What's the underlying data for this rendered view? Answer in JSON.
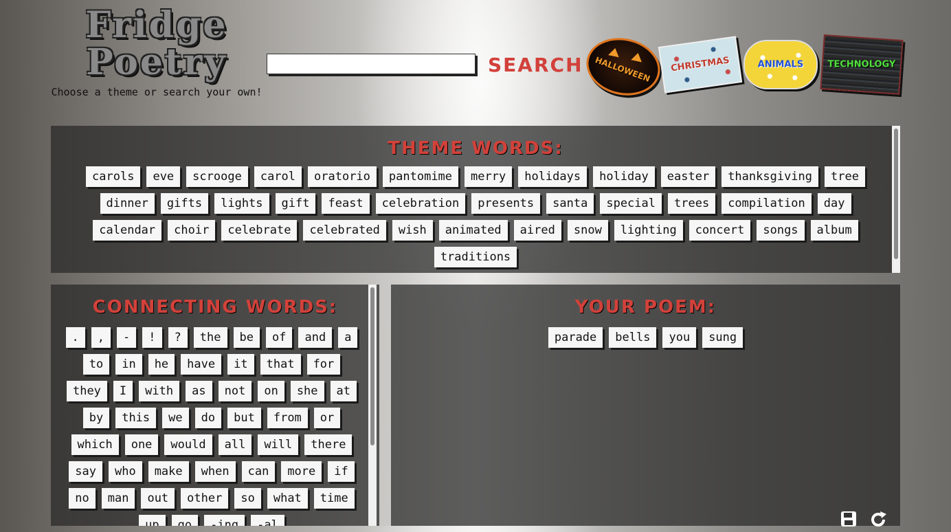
{
  "header": {
    "title": "Fridge\nPoetry",
    "subtitle": "Choose a theme or search your own!",
    "search": {
      "value": "",
      "button_label": "SEARCH"
    },
    "themes": [
      {
        "label": "HALLOWEEN",
        "icon": "halloween-badge",
        "color": "#f19a2a"
      },
      {
        "label": "CHRISTMAS",
        "icon": "christmas-badge",
        "color": "#c0392b"
      },
      {
        "label": "ANIMALS",
        "icon": "animals-badge",
        "color": "#1f4fd8"
      },
      {
        "label": "TECHNOLOGY",
        "icon": "technology-badge",
        "color": "#4fe03a"
      }
    ]
  },
  "accent_color": "#d2413a",
  "theme_words": {
    "title": "THEME WORDS:",
    "words": [
      "carols",
      "eve",
      "scrooge",
      "carol",
      "oratorio",
      "pantomime",
      "merry",
      "holidays",
      "holiday",
      "easter",
      "thanksgiving",
      "tree",
      "dinner",
      "gifts",
      "lights",
      "gift",
      "feast",
      "celebration",
      "presents",
      "santa",
      "special",
      "trees",
      "compilation",
      "day",
      "calendar",
      "choir",
      "celebrate",
      "celebrated",
      "wish",
      "animated",
      "aired",
      "snow",
      "lighting",
      "concert",
      "songs",
      "album",
      "traditions"
    ]
  },
  "connecting_words": {
    "title": "CONNECTING WORDS:",
    "words": [
      ".",
      ",",
      "-",
      "!",
      "?",
      "the",
      "be",
      "of",
      "and",
      "a",
      "to",
      "in",
      "he",
      "have",
      "it",
      "that",
      "for",
      "they",
      "I",
      "with",
      "as",
      "not",
      "on",
      "she",
      "at",
      "by",
      "this",
      "we",
      "do",
      "but",
      "from",
      "or",
      "which",
      "one",
      "would",
      "all",
      "will",
      "there",
      "say",
      "who",
      "make",
      "when",
      "can",
      "more",
      "if",
      "no",
      "man",
      "out",
      "other",
      "so",
      "what",
      "time",
      "up",
      "go",
      "-ing",
      "-al"
    ]
  },
  "poem": {
    "title": "YOUR POEM:",
    "words": [
      "parade",
      "bells",
      "you",
      "sung"
    ]
  },
  "actions": {
    "save_icon": "save-icon",
    "reset_icon": "refresh-icon"
  }
}
